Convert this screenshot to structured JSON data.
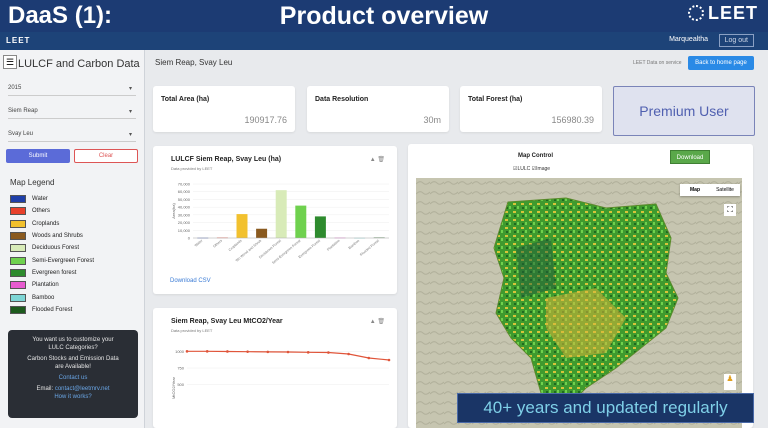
{
  "slide": {
    "left_title": "DaaS (1):",
    "center_title": "Product overview",
    "logo_text": "LEET"
  },
  "topnav": {
    "brand": "LEET",
    "user": "Marquealtha",
    "logout": "Log out"
  },
  "sidebar": {
    "title": "LULCF and Carbon Data",
    "year": "2015",
    "province": "Siem Reap",
    "district": "Svay Leu",
    "submit": "Submit",
    "clear": "Clear",
    "legend_title": "Map Legend",
    "legend": [
      {
        "label": "Water",
        "color": "#1f3fa8"
      },
      {
        "label": "Others",
        "color": "#e8412b"
      },
      {
        "label": "Croplands",
        "color": "#f2c12e"
      },
      {
        "label": "Woods and Shrubs",
        "color": "#8a5a1f"
      },
      {
        "label": "Deciduous Forest",
        "color": "#d8ebb8"
      },
      {
        "label": "Semi-Evergreen Forest",
        "color": "#6fd14e"
      },
      {
        "label": "Evergreen forest",
        "color": "#2e8b2e"
      },
      {
        "label": "Plantation",
        "color": "#e85bd0"
      },
      {
        "label": "Bamboo",
        "color": "#7ed6d6"
      },
      {
        "label": "Flooded Forest",
        "color": "#1d5a1d"
      }
    ],
    "promo": {
      "line1": "You want us to customize your",
      "line2": "LULC Categories?",
      "line3": "Carbon Stocks and Emission Data",
      "line4": "are Available!",
      "contact": "Contact us",
      "email_label": "Email:",
      "email": "contact@leetmrv.net",
      "how": "How it works?"
    }
  },
  "main": {
    "breadcrumb": "Siem Reap, Svay Leu",
    "note": "LEET Data on service",
    "home_button": "Back to home page",
    "stats": [
      {
        "label": "Total Area (ha)",
        "value": "190917.76"
      },
      {
        "label": "Data Resolution",
        "value": "30m"
      },
      {
        "label": "Total Forest (ha)",
        "value": "156980.39"
      }
    ],
    "premium": "Premium User",
    "lulcf_chart": {
      "title": "LULCF Siem Reap, Svay Leu (ha)",
      "subtitle": "Data provided by LEET",
      "download": "Download CSV"
    },
    "co2_chart": {
      "title": "Siem Reap, Svay Leu MtCO2/Year",
      "subtitle": "Data provided by LEET"
    },
    "map": {
      "title": "Map Control",
      "check_lulc": "LULC",
      "check_image": "Image",
      "download": "Download",
      "tab_map": "Map",
      "tab_satellite": "Satellite"
    }
  },
  "caption": "40+ years and updated regularly",
  "chart_data": [
    {
      "type": "bar",
      "title": "LULCF Siem Reap, Svay Leu (ha)",
      "ylabel": "Area(ha)",
      "ylim": [
        0,
        70000
      ],
      "yticks": [
        "70,000",
        "60,000",
        "50,000",
        "40,000",
        "30,000",
        "20,000",
        "10,000",
        "0"
      ],
      "categories": [
        "Water",
        "Others",
        "Croplands",
        "Wo Wood and Shrub",
        "Deciduous Forest",
        "Semi-Evergreen Forest",
        "Evergreen Forest",
        "Plantation",
        "Bamboo",
        "Flooded Forest"
      ],
      "values": [
        300,
        500,
        31000,
        12000,
        62000,
        42000,
        28000,
        400,
        200,
        600
      ],
      "colors": [
        "#1f3fa8",
        "#e8412b",
        "#f2c12e",
        "#8a5a1f",
        "#d8ebb8",
        "#6fd14e",
        "#2e8b2e",
        "#e85bd0",
        "#7ed6d6",
        "#1d5a1d"
      ]
    },
    {
      "type": "line",
      "title": "Siem Reap, Svay Leu MtCO2/Year",
      "ylabel": "MtCO2/Year",
      "ylim": [
        0,
        1200
      ],
      "yticks": [
        "1000",
        "750",
        "500"
      ],
      "values": [
        1000,
        1000,
        998,
        995,
        992,
        990,
        985,
        982,
        960,
        900,
        870
      ]
    }
  ]
}
